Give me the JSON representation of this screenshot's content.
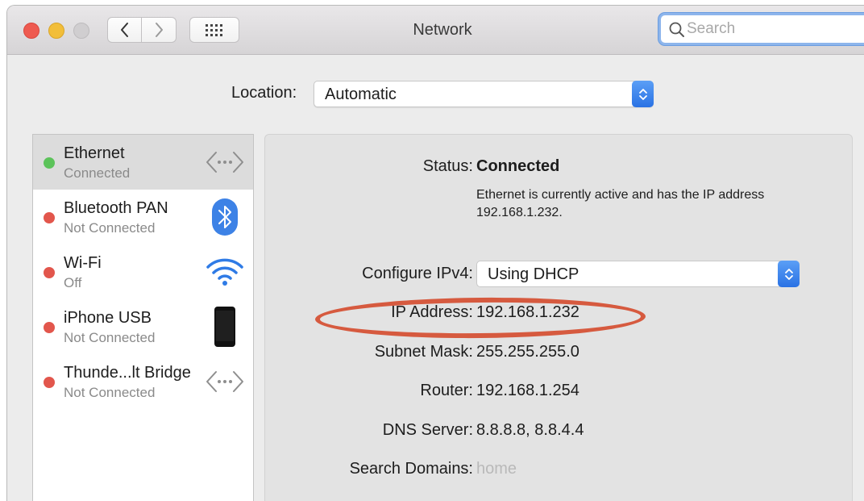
{
  "window": {
    "title": "Network",
    "search_placeholder": "Search"
  },
  "location": {
    "label": "Location:",
    "value": "Automatic"
  },
  "services": [
    {
      "name": "Ethernet",
      "status": "Connected",
      "status_color": "#5cc35a",
      "icon": "ethernet-icon",
      "selected": true
    },
    {
      "name": "Bluetooth PAN",
      "status": "Not Connected",
      "status_color": "#e2564c",
      "icon": "bluetooth-icon"
    },
    {
      "name": "Wi-Fi",
      "status": "Off",
      "status_color": "#e2564c",
      "icon": "wifi-icon"
    },
    {
      "name": "iPhone USB",
      "status": "Not Connected",
      "status_color": "#e2564c",
      "icon": "iphone-icon"
    },
    {
      "name": "Thunde...lt Bridge",
      "status": "Not Connected",
      "status_color": "#e2564c",
      "icon": "thunderbolt-bridge-icon"
    }
  ],
  "details": {
    "status_label": "Status:",
    "status_value": "Connected",
    "status_description": "Ethernet is currently active and has the IP address 192.168.1.232.",
    "configure_label": "Configure IPv4:",
    "configure_value": "Using DHCP",
    "ip_label": "IP Address:",
    "ip_value": "192.168.1.232",
    "subnet_label": "Subnet Mask:",
    "subnet_value": "255.255.255.0",
    "router_label": "Router:",
    "router_value": "192.168.1.254",
    "dns_label": "DNS Server:",
    "dns_value": "8.8.8.8, 8.8.4.4",
    "search_domains_label": "Search Domains:",
    "search_domains_value": "home"
  },
  "colors": {
    "annotation": "#d65a3f",
    "accent": "#2a72e4"
  }
}
